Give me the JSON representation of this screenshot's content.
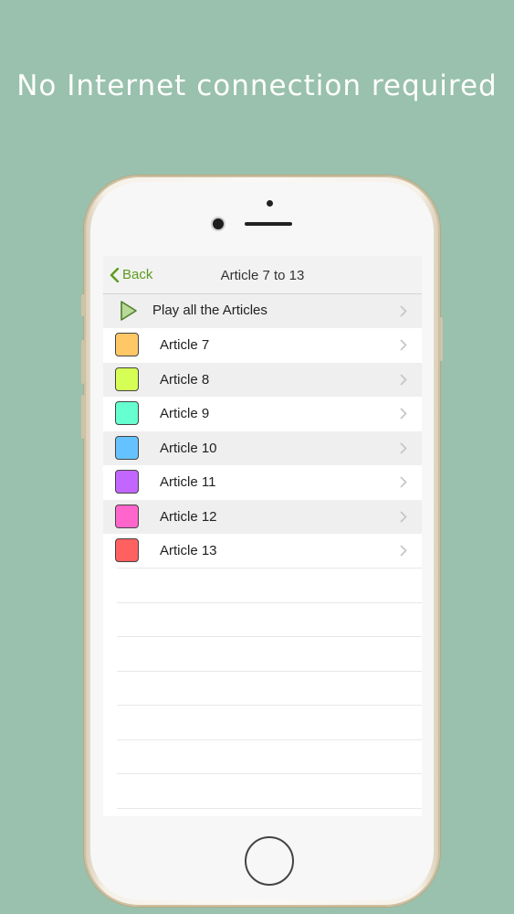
{
  "headline": "No Internet connection required",
  "nav": {
    "back_label": "Back",
    "title": "Article 7 to 13"
  },
  "play_all": {
    "label": "Play all the Articles"
  },
  "articles": [
    {
      "label": "Article 7",
      "color": "#ffc766"
    },
    {
      "label": "Article 8",
      "color": "#d6ff55"
    },
    {
      "label": "Article 9",
      "color": "#66ffcf"
    },
    {
      "label": "Article 10",
      "color": "#66c2ff"
    },
    {
      "label": "Article 11",
      "color": "#c266ff"
    },
    {
      "label": "Article 12",
      "color": "#ff66cc"
    },
    {
      "label": "Article 13",
      "color": "#ff6060"
    }
  ],
  "colors": {
    "accent": "#5d9b1f",
    "background": "#99c1ad"
  }
}
